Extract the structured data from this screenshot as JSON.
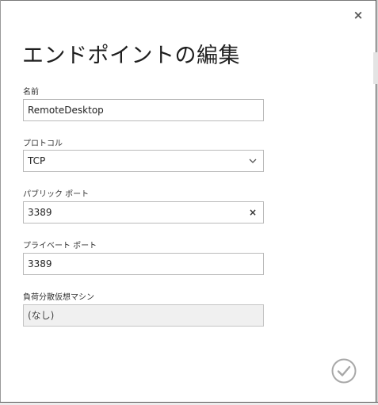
{
  "dialog": {
    "title": "エンドポイントの編集",
    "close_symbol": "×",
    "close_icon": "close-icon",
    "confirm_icon": "checkmark-icon"
  },
  "fields": {
    "name": {
      "label": "名前",
      "value": "RemoteDesktop"
    },
    "protocol": {
      "label": "プロトコル",
      "value": "TCP",
      "icon": "chevron-down-icon"
    },
    "public_port": {
      "label": "パブリック ポート",
      "value": "3389",
      "clear_symbol": "×"
    },
    "private_port": {
      "label": "プライベート ポート",
      "value": "3389"
    },
    "load_balanced_vm": {
      "label": "負荷分散仮想マシン",
      "value": "(なし)"
    }
  },
  "colors": {
    "border": "#bababa",
    "disabled_bg": "#f0f0f0",
    "icon_gray": "#a8a8a8"
  }
}
